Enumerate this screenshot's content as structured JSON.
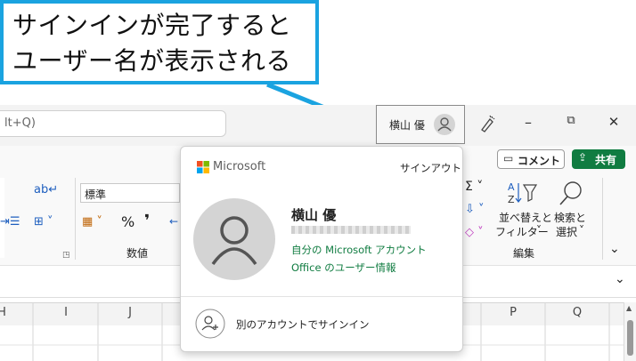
{
  "callout": {
    "line1": "サインインが完了すると",
    "line2": "ユーザー名が表示される"
  },
  "titlebar": {
    "search_text": "lt+Q)",
    "user_name": "横山 優",
    "controls": {
      "minimize": "–",
      "restore": "⧉",
      "close": "✕"
    }
  },
  "ribbon": {
    "comment_label": "コメント",
    "share_label": "共有",
    "number_format": "標準",
    "percent": "%",
    "comma": "❜",
    "group_number": "数値",
    "group_edit": "編集",
    "sort_filter_line1": "並べ替えと",
    "sort_filter_line2": "フィルター",
    "find_select_line1": "検索と",
    "find_select_line2": "選択"
  },
  "columns": [
    "H",
    "I",
    "J",
    "P",
    "Q"
  ],
  "account_popup": {
    "brand": "Microsoft",
    "sign_out": "サインアウト",
    "display_name": "横山 優",
    "link_account": "自分の Microsoft アカウント",
    "link_office": "Office のユーザー情報",
    "switch_account": "別のアカウントでサインイン"
  },
  "colors": {
    "callout_border": "#1aa3e0",
    "share_button": "#107c41",
    "link": "#107c41"
  }
}
